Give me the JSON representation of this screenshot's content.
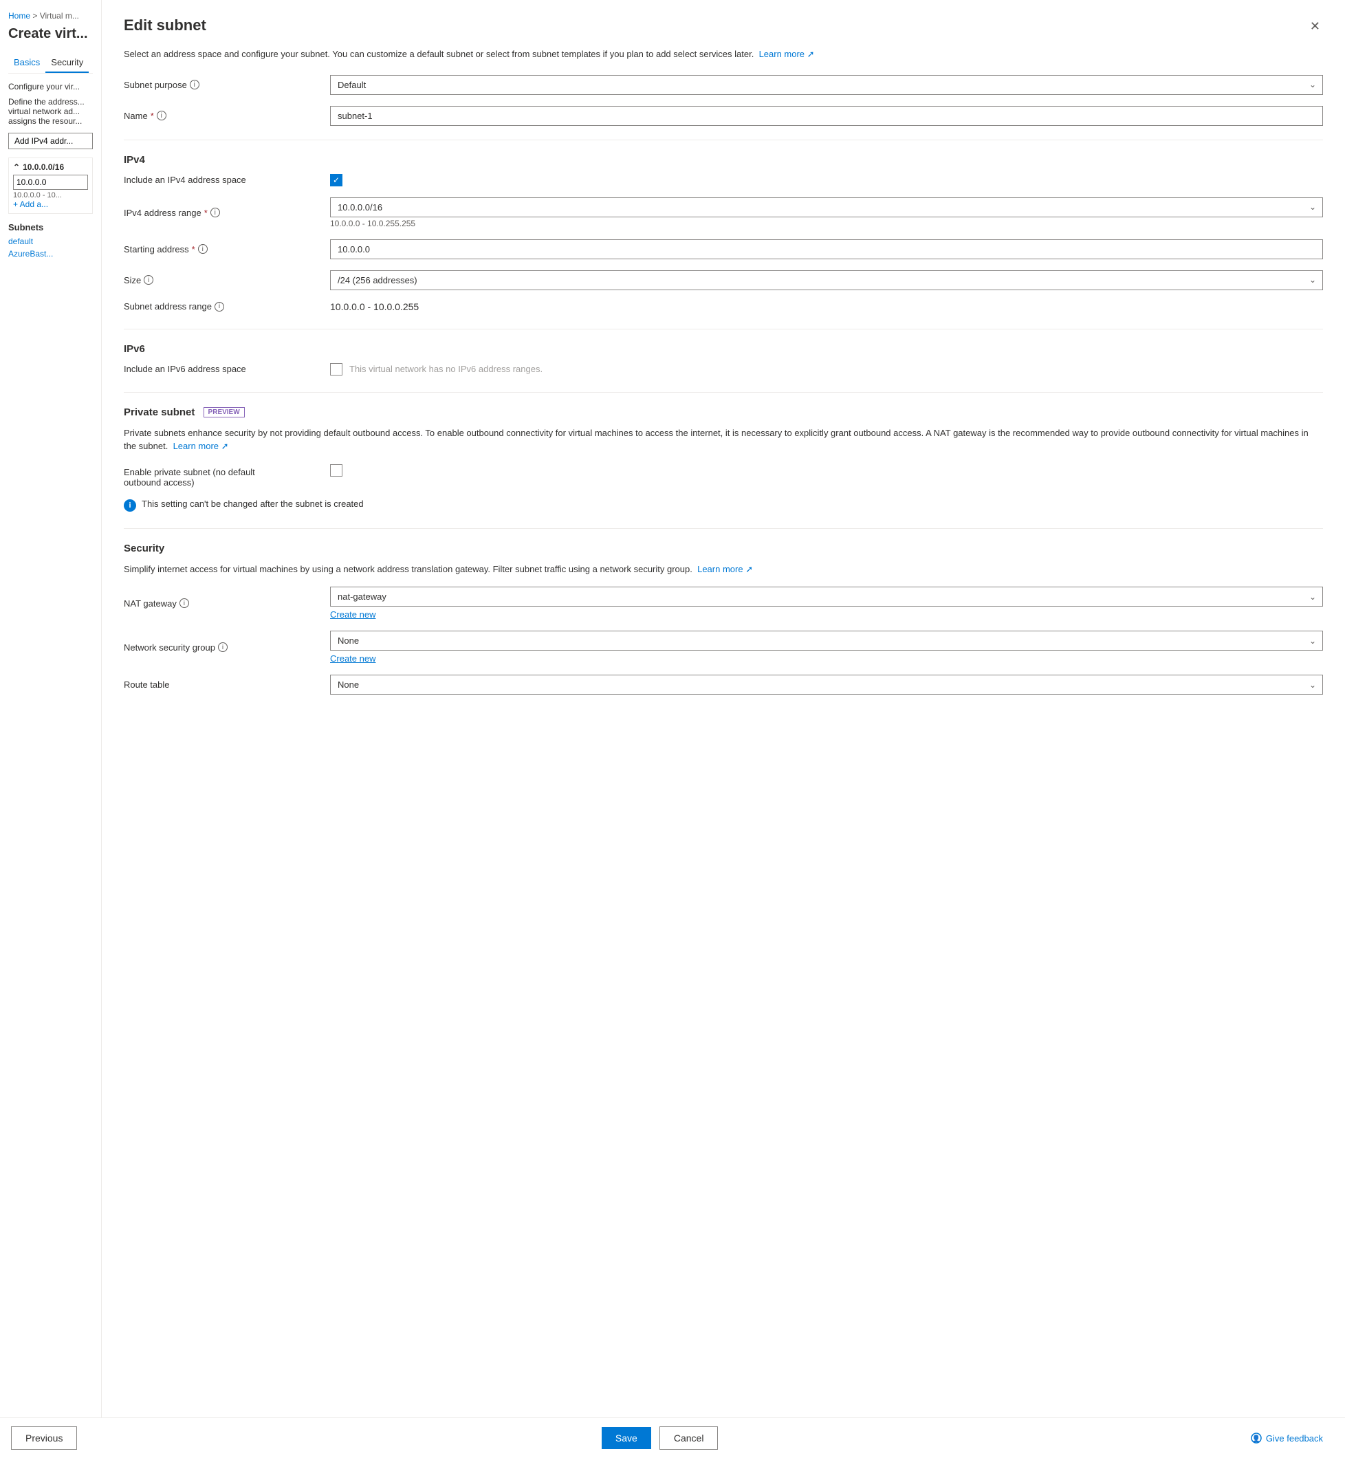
{
  "leftPanel": {
    "breadcrumb": {
      "home": "Home",
      "separator": " > ",
      "current": "Virtual m..."
    },
    "pageTitle": "Create virt...",
    "tabs": [
      {
        "label": "Basics",
        "active": false
      },
      {
        "label": "Security",
        "active": true
      }
    ],
    "sectionDesc1": "Configure your vir...",
    "sectionDesc2": "Define the address... virtual network ad... assigns the resour...",
    "addIpv4Btn": "Add IPv4 addr...",
    "ipBlock": {
      "header": "10.0.0.0/16",
      "inputValue": "10.0.0.0",
      "range": "10.0.0.0 - 10...",
      "addLink": "+ Add a..."
    },
    "subnets": {
      "label": "Subnets",
      "items": [
        "default",
        "AzureBast..."
      ]
    }
  },
  "drawer": {
    "title": "Edit subnet",
    "introText": "Select an address space and configure your subnet. You can customize a default subnet or select from subnet templates if you plan to add select services later.",
    "learnMoreLabel": "Learn more",
    "sections": {
      "subnetPurpose": {
        "label": "Subnet purpose",
        "value": "Default"
      },
      "name": {
        "label": "Name",
        "required": true,
        "value": "subnet-1"
      },
      "ipv4": {
        "heading": "IPv4",
        "includeLabel": "Include an IPv4 address space",
        "checked": true,
        "rangeLabel": "IPv4 address range",
        "required": true,
        "rangeValue": "10.0.0.0/16",
        "rangeSubText": "10.0.0.0 - 10.0.255.255",
        "startingAddressLabel": "Starting address",
        "required2": true,
        "startingAddressValue": "10.0.0.0",
        "sizeLabel": "Size",
        "sizeValue": "/24 (256 addresses)",
        "subnetAddressRangeLabel": "Subnet address range",
        "subnetAddressRangeValue": "10.0.0.0 - 10.0.0.255"
      },
      "ipv6": {
        "heading": "IPv6",
        "includeLabel": "Include an IPv6 address space",
        "disabledText": "This virtual network has no IPv6 address ranges."
      },
      "privateSubnet": {
        "heading": "Private subnet",
        "previewBadge": "PREVIEW",
        "descText": "Private subnets enhance security by not providing default outbound access. To enable outbound connectivity for virtual machines to access the internet, it is necessary to explicitly grant outbound access. A NAT gateway is the recommended way to provide outbound connectivity for virtual machines in the subnet.",
        "learnMoreLabel": "Learn more",
        "enableLabel": "Enable private subnet (no default\noutbound access)",
        "checked": false,
        "infoText": "This setting can't be changed after the subnet is created"
      },
      "security": {
        "heading": "Security",
        "descText": "Simplify internet access for virtual machines by using a network address translation gateway. Filter subnet traffic using a network security group.",
        "learnMoreLabel": "Learn more",
        "natGateway": {
          "label": "NAT gateway",
          "value": "nat-gateway",
          "createNewLabel": "Create new"
        },
        "networkSecurityGroup": {
          "label": "Network security group",
          "value": "None",
          "createNewLabel": "Create new"
        },
        "routeTable": {
          "label": "Route table",
          "value": "None"
        }
      }
    },
    "footer": {
      "saveLabel": "Save",
      "cancelLabel": "Cancel",
      "previousLabel": "Previous",
      "giveFeedbackLabel": "Give feedback"
    }
  }
}
